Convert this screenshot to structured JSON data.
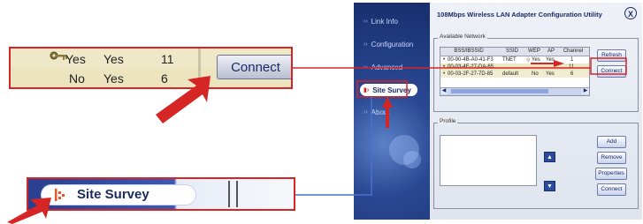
{
  "zoom_connect": {
    "row1": {
      "wep": "Yes",
      "ap": "Yes",
      "channel": "11"
    },
    "row2": {
      "wep": "No",
      "ap": "Yes",
      "channel": "6"
    },
    "connect_label": "Connect",
    "key_icon": "key-icon"
  },
  "zoom_survey": {
    "label": "Site Survey",
    "icon": "site-survey-icon"
  },
  "app": {
    "title": "108Mbps Wireless LAN Adapter Configuration Utility",
    "close_label": "X",
    "sidebar": {
      "items": [
        {
          "label": "Link Info"
        },
        {
          "label": "Configuration"
        },
        {
          "label": "Advanced"
        },
        {
          "label": "Site Survey"
        },
        {
          "label": "About"
        }
      ]
    },
    "available_network": {
      "label": "Available Network",
      "columns": [
        "BSS/IBSSID",
        "SSID",
        "WEP",
        "AP",
        "Channel"
      ],
      "rows": [
        {
          "bssid": "00-90-4B-A0-41-F3",
          "ssid": "TNET",
          "wep": "Yes",
          "ap": "Yes",
          "channel": "1"
        },
        {
          "bssid": "00-03-4F-27-DA-65",
          "ssid": "",
          "wep": "",
          "ap": "",
          "channel": "11"
        },
        {
          "bssid": "00-03-2F-27-7D-85",
          "ssid": "default",
          "wep": "No",
          "ap": "Yes",
          "channel": "6"
        }
      ],
      "refresh_label": "Refresh",
      "connect_label": "Connect"
    },
    "profile": {
      "label": "Profile",
      "add_label": "Add",
      "remove_label": "Remove",
      "properties_label": "Properties",
      "connect_label": "Connect"
    }
  },
  "colors": {
    "callout_red": "#d62525",
    "sidebar_blue": "#1f3a82",
    "button_text": "#1b2a6a"
  }
}
